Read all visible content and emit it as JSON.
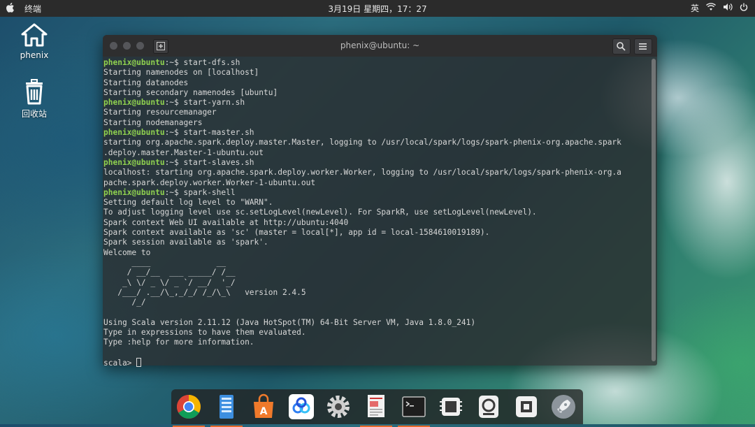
{
  "topbar": {
    "app_menu": "终端",
    "clock": "3月19日 星期四，17：27",
    "input_method": "英"
  },
  "desktop": {
    "icons": [
      {
        "label": "phenix",
        "icon": "home-folder-icon"
      },
      {
        "label": "回收站",
        "icon": "trash-icon"
      }
    ]
  },
  "terminal": {
    "title": "phenix@ubuntu: ~",
    "prompt_user": "phenix@ubuntu",
    "prompt_path": ":~$ ",
    "lines": {
      "l1_cmd": "start-dfs.sh",
      "l2": "Starting namenodes on [localhost]",
      "l3": "Starting datanodes",
      "l4": "Starting secondary namenodes [ubuntu]",
      "l5_cmd": "start-yarn.sh",
      "l6": "Starting resourcemanager",
      "l7": "Starting nodemanagers",
      "l8_cmd": "start-master.sh",
      "l9": "starting org.apache.spark.deploy.master.Master, logging to /usr/local/spark/logs/spark-phenix-org.apache.spark",
      "l10": ".deploy.master.Master-1-ubuntu.out",
      "l11_cmd": "start-slaves.sh",
      "l12": "localhost: starting org.apache.spark.deploy.worker.Worker, logging to /usr/local/spark/logs/spark-phenix-org.a",
      "l13": "pache.spark.deploy.worker.Worker-1-ubuntu.out",
      "l14_cmd": "spark-shell",
      "l15": "Setting default log level to \"WARN\".",
      "l16": "To adjust logging level use sc.setLogLevel(newLevel). For SparkR, use setLogLevel(newLevel).",
      "l17": "Spark context Web UI available at http://ubuntu:4040",
      "l18": "Spark context available as 'sc' (master = local[*], app id = local-1584610019189).",
      "l19": "Spark session available as 'spark'.",
      "l20": "Welcome to",
      "logo1": "      ____              __",
      "logo2": "     / __/__  ___ _____/ /__",
      "logo3": "    _\\ \\/ _ \\/ _ `/ __/  '_/",
      "logo4": "   /___/ .__/\\_,_/_/ /_/\\_\\   version 2.4.5",
      "logo5": "      /_/",
      "l21": "Using Scala version 2.11.12 (Java HotSpot(TM) 64-Bit Server VM, Java 1.8.0_241)",
      "l22": "Type in expressions to have them evaluated.",
      "l23": "Type :help for more information.",
      "scala_prompt": "scala> "
    }
  },
  "dock": {
    "items": [
      {
        "name": "chrome",
        "icon": "chrome-icon",
        "running": true
      },
      {
        "name": "files",
        "icon": "file-manager-icon",
        "running": true
      },
      {
        "name": "app-store",
        "icon": "app-store-icon",
        "running": false
      },
      {
        "name": "baidu-netdisk",
        "icon": "cloud-drive-icon",
        "running": false
      },
      {
        "name": "settings",
        "icon": "gear-icon",
        "running": false
      },
      {
        "name": "document-viewer",
        "icon": "document-icon",
        "running": true
      },
      {
        "name": "terminal",
        "icon": "terminal-icon",
        "running": true
      },
      {
        "name": "system-monitor",
        "icon": "chip-icon",
        "running": false
      },
      {
        "name": "disk-utility",
        "icon": "disk-icon",
        "running": false
      },
      {
        "name": "hardware-info",
        "icon": "chip-icon",
        "running": false
      },
      {
        "name": "launcher",
        "icon": "rocket-icon",
        "running": false
      }
    ],
    "indicator_color": "#e86a2a"
  },
  "colors": {
    "prompt": "#8fd14f",
    "terminal_text": "#d8d8d8",
    "topbar_bg": "#2b2b2b"
  }
}
